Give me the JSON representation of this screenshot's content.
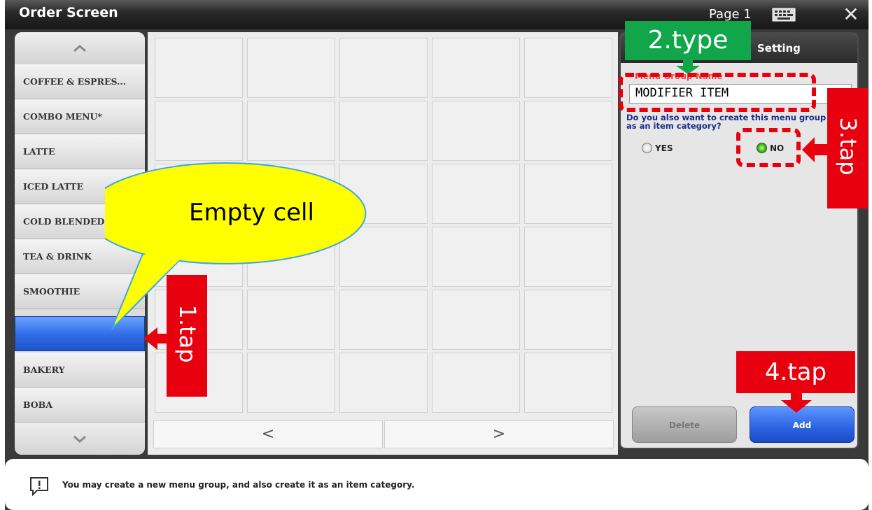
{
  "window": {
    "title": "Order Screen",
    "page_label": "Page 1"
  },
  "categories": {
    "items": [
      {
        "label": "COFFEE & ESPRES..."
      },
      {
        "label": "COMBO MENU*"
      },
      {
        "label": "LATTE"
      },
      {
        "label": "ICED LATTE"
      },
      {
        "label": "COLD BLENDED D..."
      },
      {
        "label": "TEA & DRINK"
      },
      {
        "label": "SMOOTHIE"
      },
      {
        "label": ""
      },
      {
        "label": "BAKERY"
      },
      {
        "label": "BOBA"
      }
    ],
    "selected_index": 7
  },
  "grid": {
    "prev_label": "<",
    "next_label": ">"
  },
  "setting": {
    "title": "Setting",
    "name_label": "Menu Group Name",
    "name_value": "MODIFIER ITEM",
    "question": "Do you also want to create this menu group as an item category?",
    "yes_label": "YES",
    "no_label": "NO",
    "selected_option": "NO",
    "delete_label": "Delete",
    "add_label": "Add"
  },
  "status": {
    "message": "You may create a new menu group, and also create it as an item category."
  },
  "annotations": {
    "callout": "Empty cell",
    "step1": "1.tap",
    "step2": "2.type",
    "step3": "3.tap",
    "step4": "4.tap"
  },
  "colors": {
    "accent_red": "#e8000e",
    "accent_green": "#12a64a",
    "selected_blue": "#2e6be6",
    "callout_yellow": "#ffff00"
  }
}
